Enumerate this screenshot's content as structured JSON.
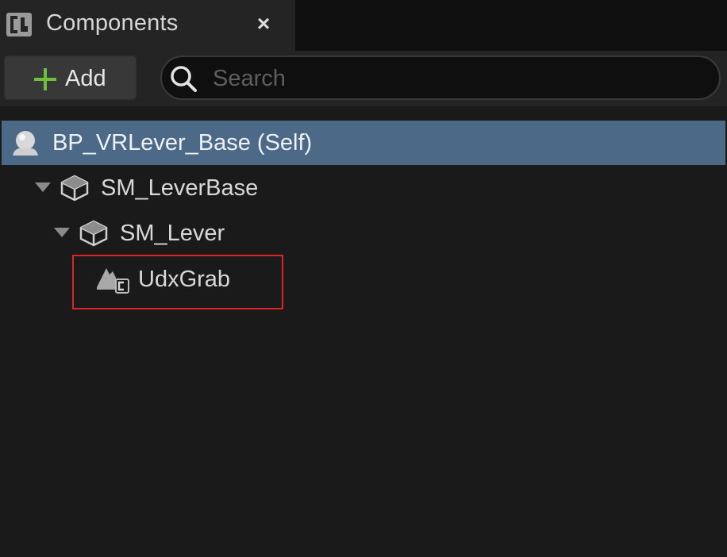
{
  "tab": {
    "title": "Components",
    "close_glyph": "×",
    "icon": "components-panel-icon"
  },
  "toolbar": {
    "add_label": "Add",
    "add_icon": "plus-icon",
    "search_placeholder": "Search",
    "search_value": "",
    "search_icon": "search-icon"
  },
  "tree": {
    "items": [
      {
        "label": "BP_VRLever_Base (Self)",
        "icon": "actor-self-icon",
        "selected": true,
        "expandable": false
      },
      {
        "label": "SM_LeverBase",
        "icon": "static-mesh-icon",
        "selected": false,
        "expandable": true,
        "expanded": true
      },
      {
        "label": "SM_Lever",
        "icon": "static-mesh-icon",
        "selected": false,
        "expandable": true,
        "expanded": true
      },
      {
        "label": "UdxGrab",
        "icon": "scene-component-icon",
        "selected": false,
        "expandable": false,
        "highlighted": true
      }
    ]
  },
  "colors": {
    "background": "#1a1a1a",
    "selection": "#4c6a87",
    "add_plus": "#6fbf3c",
    "highlight_box": "#e02424"
  }
}
